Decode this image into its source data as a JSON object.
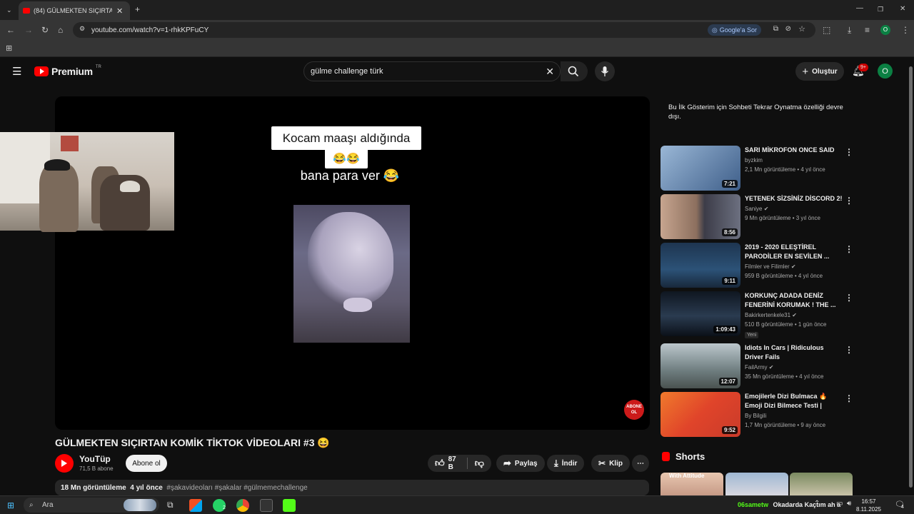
{
  "browser": {
    "tab_title": "(84) GÜLMEKTEN SIÇIRTAN KO",
    "url": "youtube.com/watch?v=1-rhkKPFuCY",
    "google_sor": "Google'a Sor",
    "profile_letter": "O"
  },
  "header": {
    "brand": "Premium",
    "region": "TR",
    "search_value": "gülme challenge türk",
    "create_label": "Oluştur",
    "notif_count": "9+",
    "avatar_letter": "O"
  },
  "video": {
    "caption_top": "Kocam maaşı aldığında",
    "caption_emoji": "😂😂",
    "caption_bottom": "bana para ver 😂",
    "abone_badge": "ABONE OL",
    "title": "GÜLMEKTEN SIÇIRTAN KOMİK TİKTOK VİDEOLARI #3 😆",
    "channel": "YouTüp",
    "subscribers": "71,5 B abone",
    "subscribe_label": "Abone ol",
    "likes": "87 B",
    "share_label": "Paylaş",
    "download_label": "İndir",
    "clip_label": "Klip",
    "views": "18 Mn görüntüleme",
    "age": "4 yıl önce",
    "tags": "#şakavideoları #şakalar #gülmemechallenge"
  },
  "sidebar": {
    "chat_note": "Bu İlk Gösterim için Sohbeti Tekrar Oynatma özelliği devre dışı.",
    "recommendations": [
      {
        "title": "SARI MİKROFON ONCE SAID",
        "channel": "byzkim",
        "meta": "2,1 Mn görüntüleme • 4 yıl önce",
        "duration": "7:21",
        "color": "#6a8fb5"
      },
      {
        "title": "YETENEK SİZSİNİZ DİSCORD 2!",
        "channel": "Saniye",
        "meta": "9 Mn görüntüleme • 3 yıl önce",
        "duration": "8:56",
        "color": "#8a7a6e"
      },
      {
        "title": "2019 - 2020 ELEŞTİREL PARODİLER EN SEVİLEN ...",
        "channel": "Filmler ve Filimler",
        "meta": "959 B görüntüleme • 4 yıl önce",
        "duration": "9:11",
        "color": "#24415e"
      },
      {
        "title": "KORKUNÇ ADADA DENİZ FENERİNİ KORUMAK ! THE ...",
        "channel": "Bakirkertenkele31",
        "meta": "510 B görüntüleme • 1 gün önce",
        "duration": "1:09:43",
        "color": "#1d2a38",
        "badge": "Yeni"
      },
      {
        "title": "Idiots In Cars | Ridiculous Driver Fails",
        "channel": "FailArmy",
        "meta": "35 Mn görüntüleme • 4 yıl önce",
        "duration": "12:07",
        "color": "#7a8a8e"
      },
      {
        "title": "Emojilerle Dizi Bulmaca 🔥 Emoji Dizi Bilmece Testi | Emoj...",
        "channel": "By Bilgili",
        "meta": "1,7 Mn görüntüleme • 9 ay önce",
        "duration": "9:52",
        "color": "#e0482a"
      }
    ],
    "shorts_label": "Shorts",
    "short_text": "With Attitude"
  },
  "taskbar": {
    "search_placeholder": "Ara",
    "whatsapp_badge": "2",
    "weather_user": "06sametw",
    "weather_text": "Okadarda Kaçtım ah a",
    "time": "16:57",
    "date": "8.11.2025",
    "notif_count": "4"
  }
}
